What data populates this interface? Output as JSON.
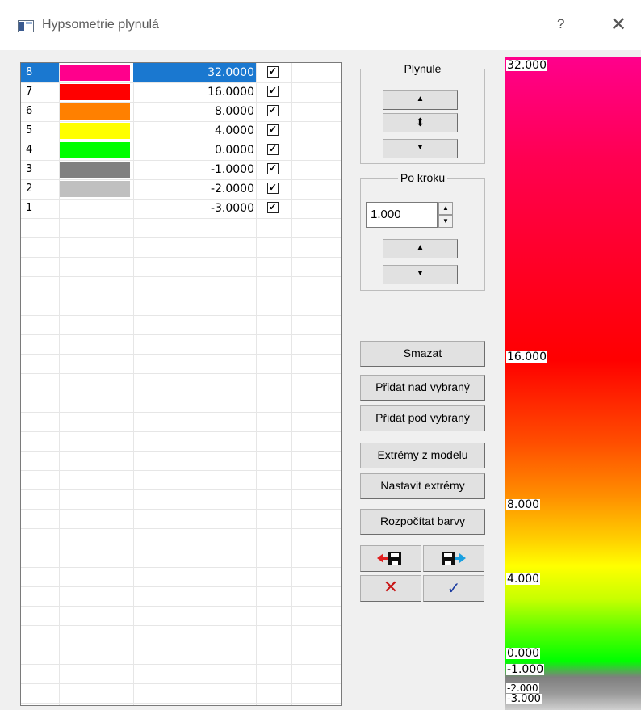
{
  "title": "Hypsometrie plynulá",
  "title_help": "?",
  "title_close": "✕",
  "rows": [
    {
      "num": "8",
      "color": "#ff008c",
      "value": "32.0000",
      "checked": "✓"
    },
    {
      "num": "7",
      "color": "#ff0000",
      "value": "16.0000",
      "checked": "✓"
    },
    {
      "num": "6",
      "color": "#ff8000",
      "value": "8.0000",
      "checked": "✓"
    },
    {
      "num": "5",
      "color": "#ffff00",
      "value": "4.0000",
      "checked": "✓"
    },
    {
      "num": "4",
      "color": "#00ff00",
      "value": "0.0000",
      "checked": "✓"
    },
    {
      "num": "3",
      "color": "#808080",
      "value": "-1.0000",
      "checked": "✓"
    },
    {
      "num": "2",
      "color": "#c0c0c0",
      "value": "-2.0000",
      "checked": "✓"
    },
    {
      "num": "1",
      "color": "#ffffff",
      "value": "-3.0000",
      "checked": "✓"
    }
  ],
  "plynule": {
    "label": "Plynule",
    "up": "▲",
    "updown": "⬍",
    "down": "▼"
  },
  "pokroku": {
    "label": "Po kroku",
    "step_value": "1.000",
    "spin_up": "▲",
    "spin_down": "▼",
    "up": "▲",
    "down": "▼"
  },
  "buttons": {
    "smazat": "Smazat",
    "pridat_nad": "Přidat nad vybraný",
    "pridat_pod": "Přidat pod vybraný",
    "extremy_z_modelu": "Extrémy z modelu",
    "nastavit_extremy": "Nastavit extrémy",
    "rozpocitat": "Rozpočítat barvy",
    "cancel": "✕",
    "ok": "✓"
  },
  "icons": {
    "load": "load-icon",
    "save": "save-icon"
  },
  "legend": {
    "labels": [
      "32.000",
      "16.000",
      "8.000",
      "4.000",
      "0.000",
      "-1.000",
      "-2.000",
      "-3.000"
    ]
  },
  "colors": {
    "selection": "#1a78d0"
  }
}
